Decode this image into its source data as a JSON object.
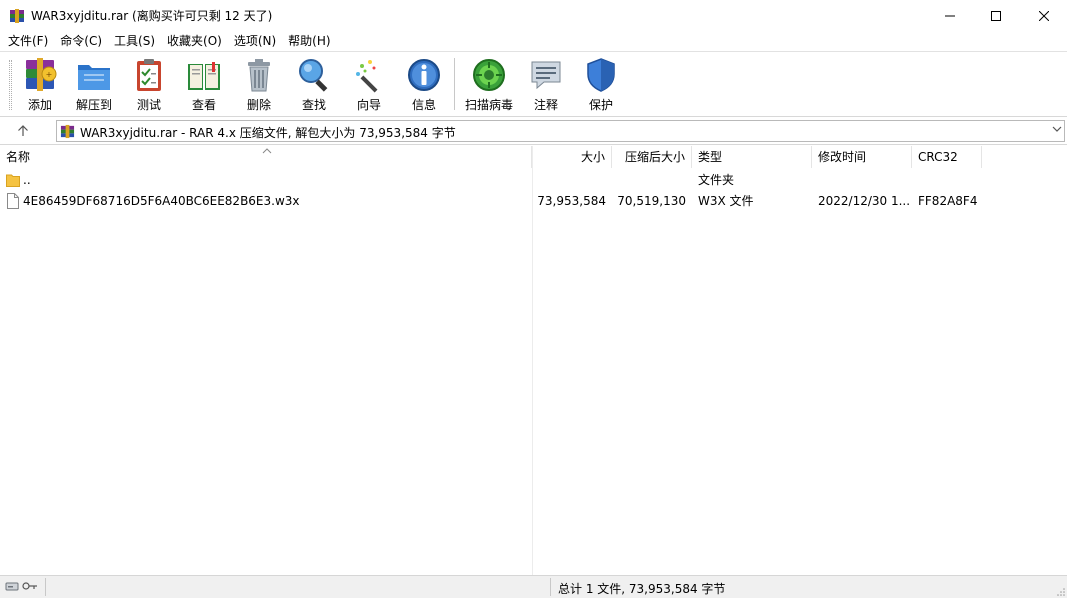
{
  "window": {
    "title": "WAR3xyjditu.rar (离购买许可只剩 12 天了)"
  },
  "menu": [
    "文件(F)",
    "命令(C)",
    "工具(S)",
    "收藏夹(O)",
    "选项(N)",
    "帮助(H)"
  ],
  "toolbar": {
    "add": "添加",
    "extract": "解压到",
    "test": "测试",
    "view": "查看",
    "delete": "删除",
    "find": "查找",
    "wizard": "向导",
    "info": "信息",
    "virusscan": "扫描病毒",
    "comment": "注释",
    "protect": "保护"
  },
  "address": {
    "text": "WAR3xyjditu.rar - RAR 4.x 压缩文件, 解包大小为 73,953,584 字节"
  },
  "columns": {
    "name": "名称",
    "size": "大小",
    "packed": "压缩后大小",
    "type": "类型",
    "modified": "修改时间",
    "crc": "CRC32"
  },
  "rows": [
    {
      "name": "..",
      "size": "",
      "packed": "",
      "type": "文件夹",
      "modified": "",
      "crc": ""
    },
    {
      "name": "4E86459DF68716D5F6A40BC6EE82B6E3.w3x",
      "size": "73,953,584",
      "packed": "70,519,130",
      "type": "W3X 文件",
      "modified": "2022/12/30 1...",
      "crc": "FF82A8F4"
    }
  ],
  "status": {
    "summary": "总计 1 文件, 73,953,584 字节"
  },
  "icons": {
    "app": "winrar-icon",
    "folder_color": "#f5c342"
  }
}
